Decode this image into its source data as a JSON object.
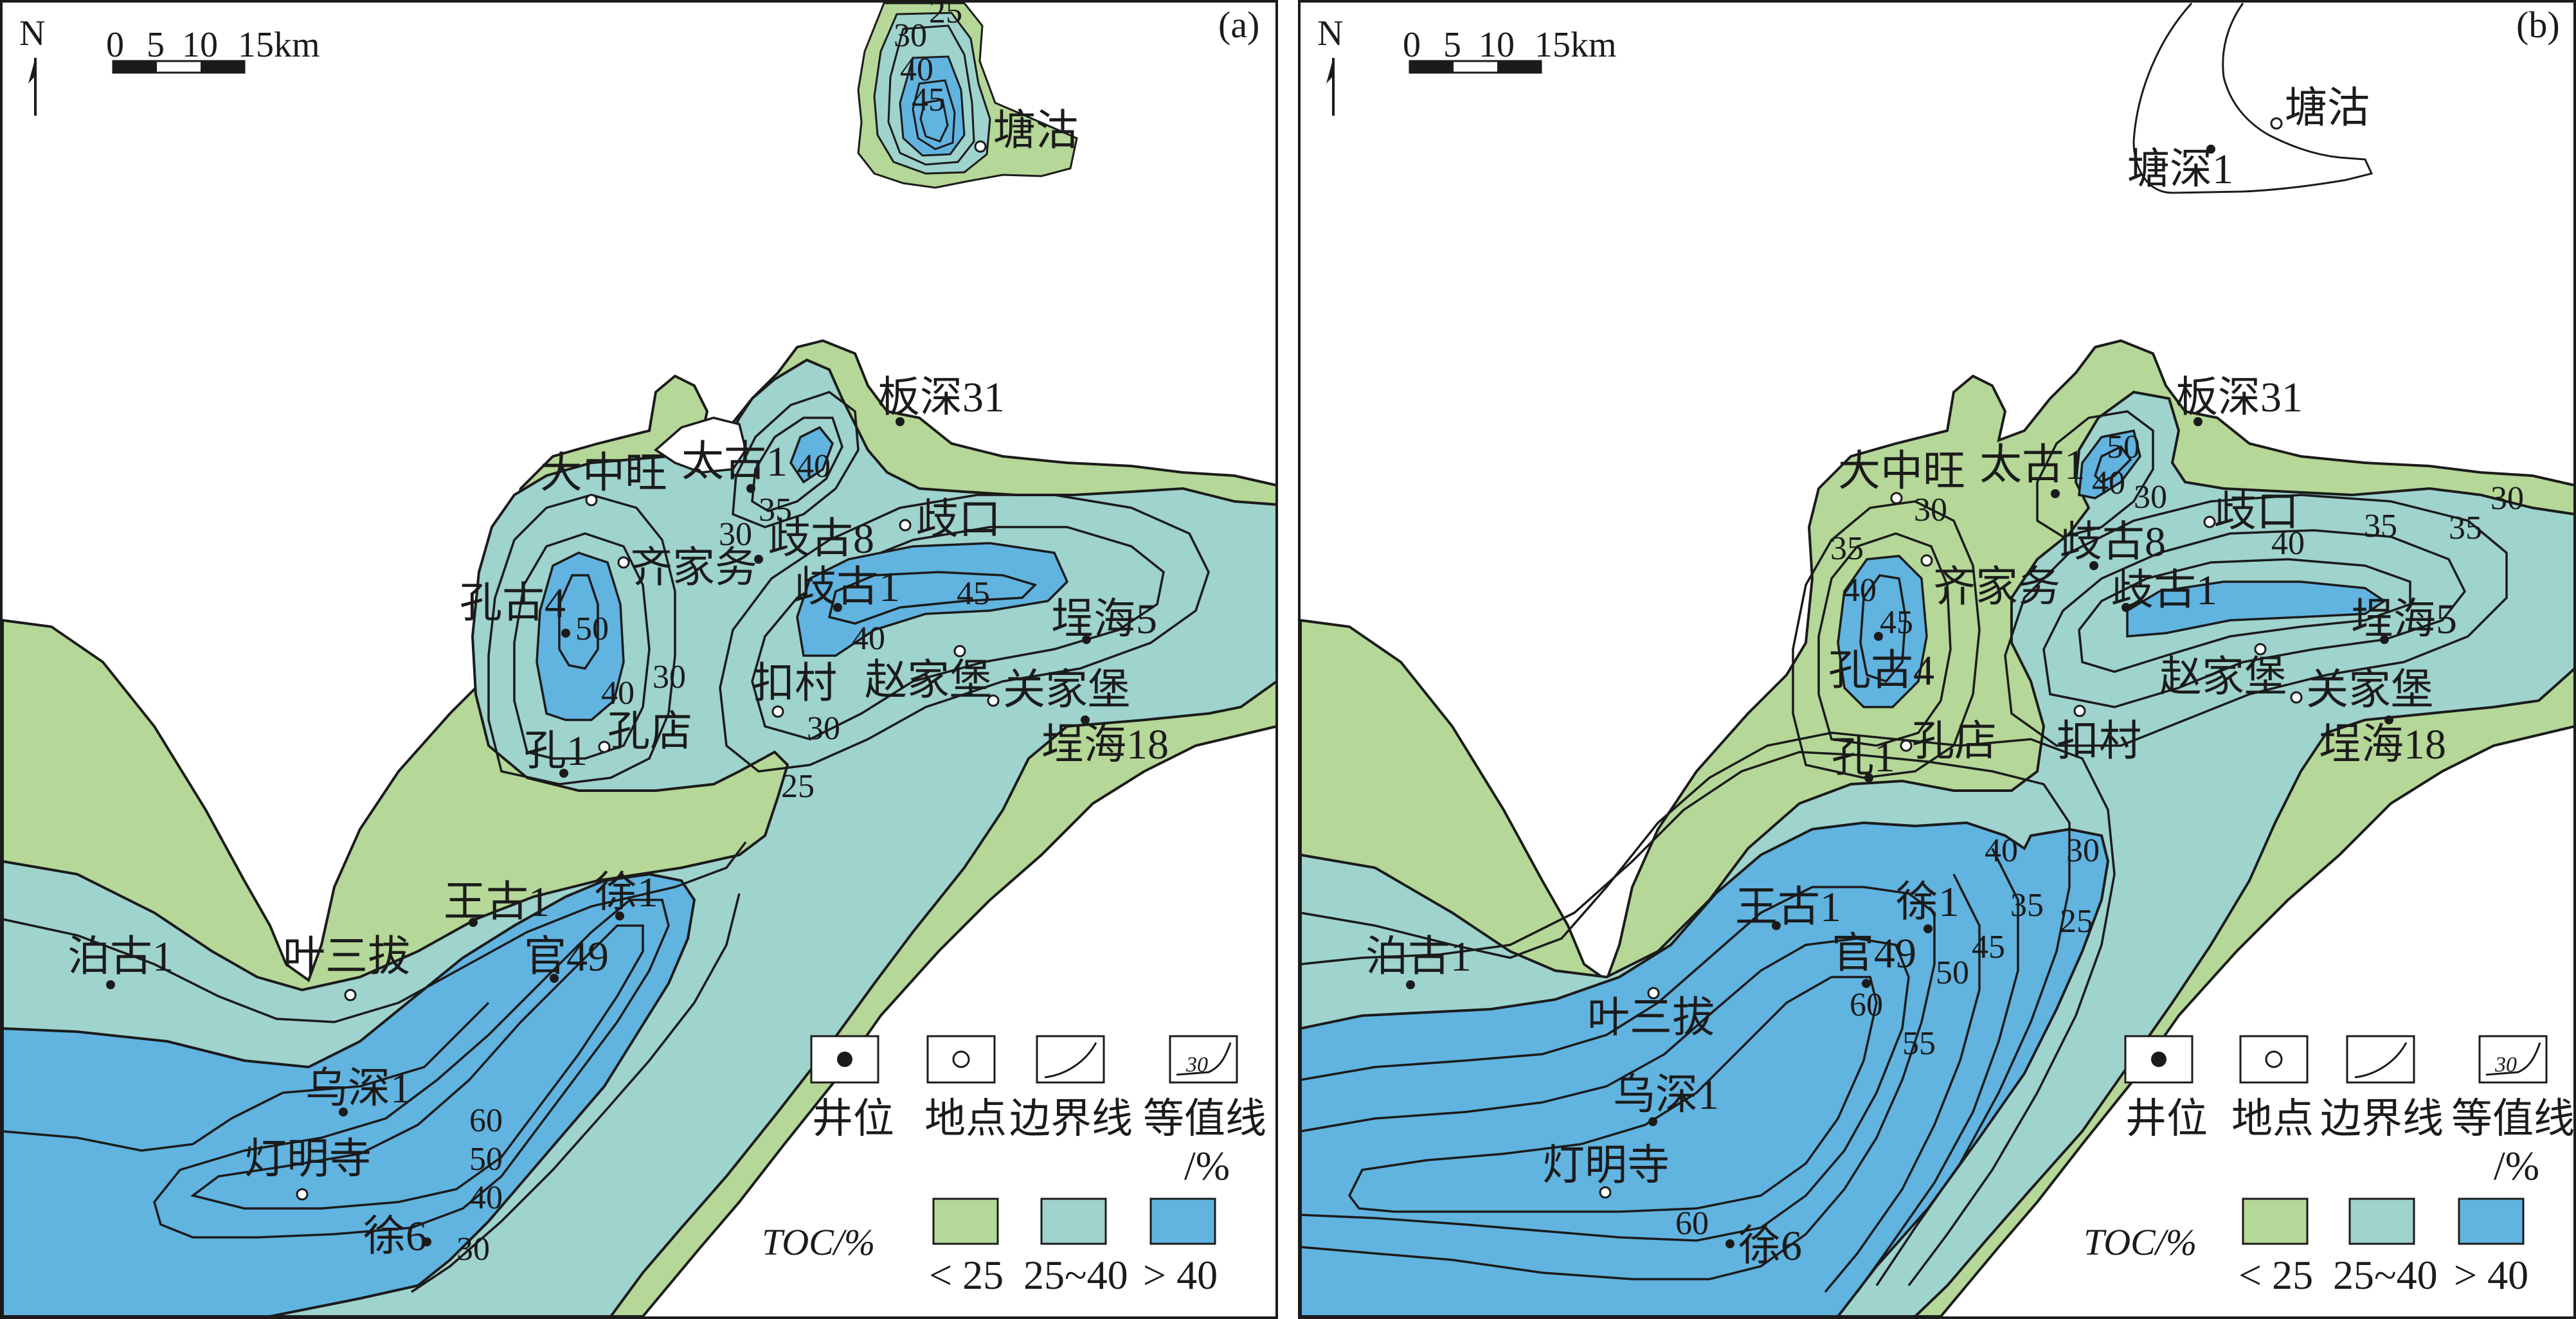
{
  "colors": {
    "low": "#b5d797",
    "mid": "#9fd3cd",
    "high": "#61b3e0",
    "line": "#1b1b1b"
  },
  "north_label": "N",
  "scale_bar": {
    "ticks": [
      "0",
      "5",
      "10"
    ],
    "end_label": "15km"
  },
  "legend": {
    "items": [
      {
        "icon": "well-dot-icon",
        "label": "井位"
      },
      {
        "icon": "place-circle-icon",
        "label": "地点"
      },
      {
        "icon": "boundary-line-icon",
        "label": "边界线"
      },
      {
        "icon": "contour-line-icon",
        "label": "等值线",
        "sub": "/%",
        "sample": "30"
      }
    ],
    "toc_label": "TOC/%",
    "ranges": [
      {
        "label": "< 25",
        "class": "low"
      },
      {
        "label": "25~40",
        "class": "mid"
      },
      {
        "label": "> 40",
        "class": "high"
      }
    ]
  },
  "panels": [
    {
      "tag": "(a)",
      "places": [
        "塘沽",
        "板深31",
        "大中旺",
        "太古1",
        "齐家务",
        "歧古8",
        "歧口",
        "孔古4",
        "歧古1",
        "埕海5",
        "扣村",
        "赵家堡",
        "关家堡",
        "孔店",
        "孔1",
        "埕海18",
        "王古1",
        "徐1",
        "泊古1",
        "叶三拔",
        "官49",
        "乌深1",
        "灯明寺",
        "徐6"
      ],
      "contour_labels": [
        "25",
        "30",
        "40",
        "45",
        "40",
        "35",
        "30",
        "50",
        "40",
        "30",
        "45",
        "40",
        "30",
        "25",
        "60",
        "50",
        "40",
        "30"
      ]
    },
    {
      "tag": "(b)",
      "places": [
        "塘沽",
        "塘深1",
        "板深31",
        "大中旺",
        "太古1",
        "歧口",
        "歧古8",
        "齐家务",
        "孔古4",
        "歧古1",
        "埕海5",
        "赵家堡",
        "关家堡",
        "孔店",
        "扣村",
        "孔1",
        "埕海18",
        "王古1",
        "徐1",
        "泊古1",
        "官49",
        "叶三拔",
        "乌深1",
        "灯明寺",
        "徐6"
      ],
      "contour_labels": [
        "50",
        "40",
        "30",
        "35",
        "30",
        "35",
        "40",
        "45",
        "40",
        "35",
        "30",
        "25",
        "30",
        "35",
        "40",
        "45",
        "50",
        "55",
        "60",
        "60"
      ]
    }
  ]
}
